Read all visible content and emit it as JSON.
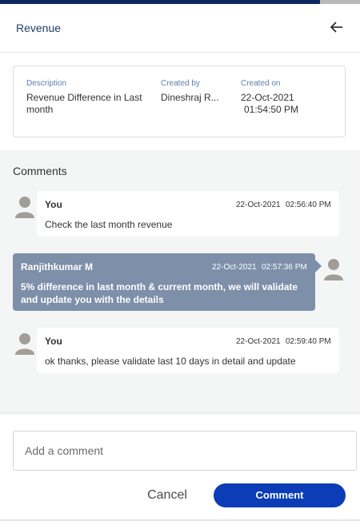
{
  "header": {
    "title": "Revenue",
    "back_icon": "arrow-left-icon"
  },
  "details": {
    "description": {
      "label": "Description",
      "value": "Revenue Difference in Last month"
    },
    "created_by": {
      "label": "Created by",
      "value": "Dineshraj R..."
    },
    "created_on": {
      "label": "Created on",
      "date": "22-Oct-2021",
      "time": "01:54:50 PM"
    }
  },
  "comments": {
    "title": "Comments",
    "items": [
      {
        "author": "You",
        "date": "22-Oct-2021",
        "time": "02:56:40 PM",
        "text": "Check the last month revenue",
        "side": "self"
      },
      {
        "author": "Ranjithkumar M",
        "date": "22-Oct-2021",
        "time": "02:57:36 PM",
        "text": "5% difference in last month & current month, we will validate and update you with the details",
        "side": "other"
      },
      {
        "author": "You",
        "date": "22-Oct-2021",
        "time": "02:59:40 PM",
        "text": "ok thanks, please validate last 10 days in detail and update",
        "side": "self"
      }
    ]
  },
  "composer": {
    "placeholder": "Add a comment",
    "value": "",
    "cancel_label": "Cancel",
    "submit_label": "Comment"
  },
  "colors": {
    "accent": "#0a3db6",
    "header_bar": "#0b2a5b",
    "other_bubble": "#7d8fa9",
    "label": "#5b7fae"
  }
}
